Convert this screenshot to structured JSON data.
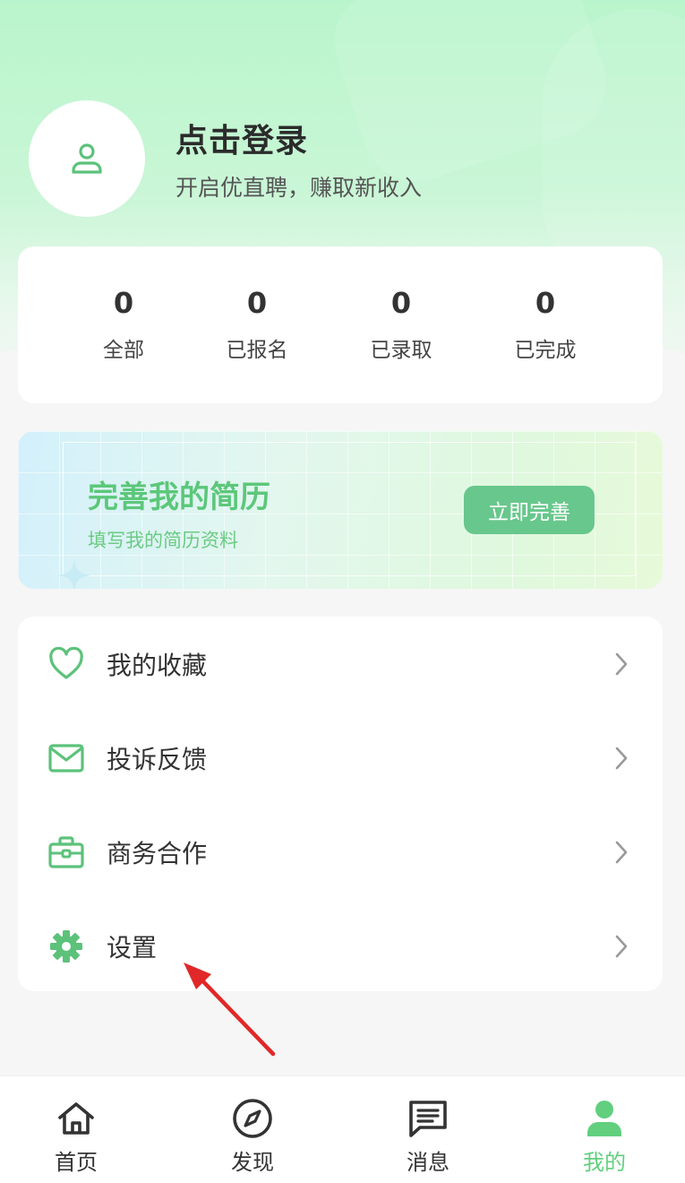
{
  "profile": {
    "title": "点击登录",
    "subtitle": "开启优直聘，赚取新收入"
  },
  "stats": [
    {
      "value": "0",
      "label": "全部"
    },
    {
      "value": "0",
      "label": "已报名"
    },
    {
      "value": "0",
      "label": "已录取"
    },
    {
      "value": "0",
      "label": "已完成"
    }
  ],
  "banner": {
    "title": "完善我的简历",
    "subtitle": "填写我的简历资料",
    "button": "立即完善"
  },
  "menu": [
    {
      "label": "我的收藏",
      "icon": "heart-icon"
    },
    {
      "label": "投诉反馈",
      "icon": "mail-icon"
    },
    {
      "label": "商务合作",
      "icon": "briefcase-icon"
    },
    {
      "label": "设置",
      "icon": "gear-icon"
    }
  ],
  "tabs": [
    {
      "label": "首页",
      "icon": "home-icon"
    },
    {
      "label": "发现",
      "icon": "compass-icon"
    },
    {
      "label": "消息",
      "icon": "message-icon"
    },
    {
      "label": "我的",
      "icon": "user-icon",
      "active": true
    }
  ],
  "colors": {
    "accent": "#62cf7e",
    "icon_green": "#5cc27a",
    "annotation_arrow": "#e02828"
  }
}
